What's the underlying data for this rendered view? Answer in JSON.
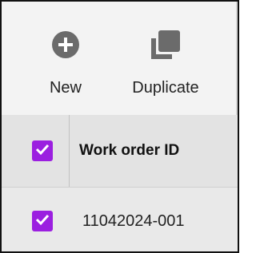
{
  "toolbar": {
    "new_label": "New",
    "new_icon": "plus-circle-icon",
    "duplicate_label": "Duplicate",
    "duplicate_icon": "copy-icon"
  },
  "grid": {
    "header": {
      "column_label": "Work order ID",
      "select_all_checked": true
    },
    "rows": [
      {
        "work_order_id": "11042024-001",
        "checked": true
      }
    ]
  },
  "colors": {
    "accent": "#9b1fe0",
    "icon_gray": "#6b6b6b"
  }
}
